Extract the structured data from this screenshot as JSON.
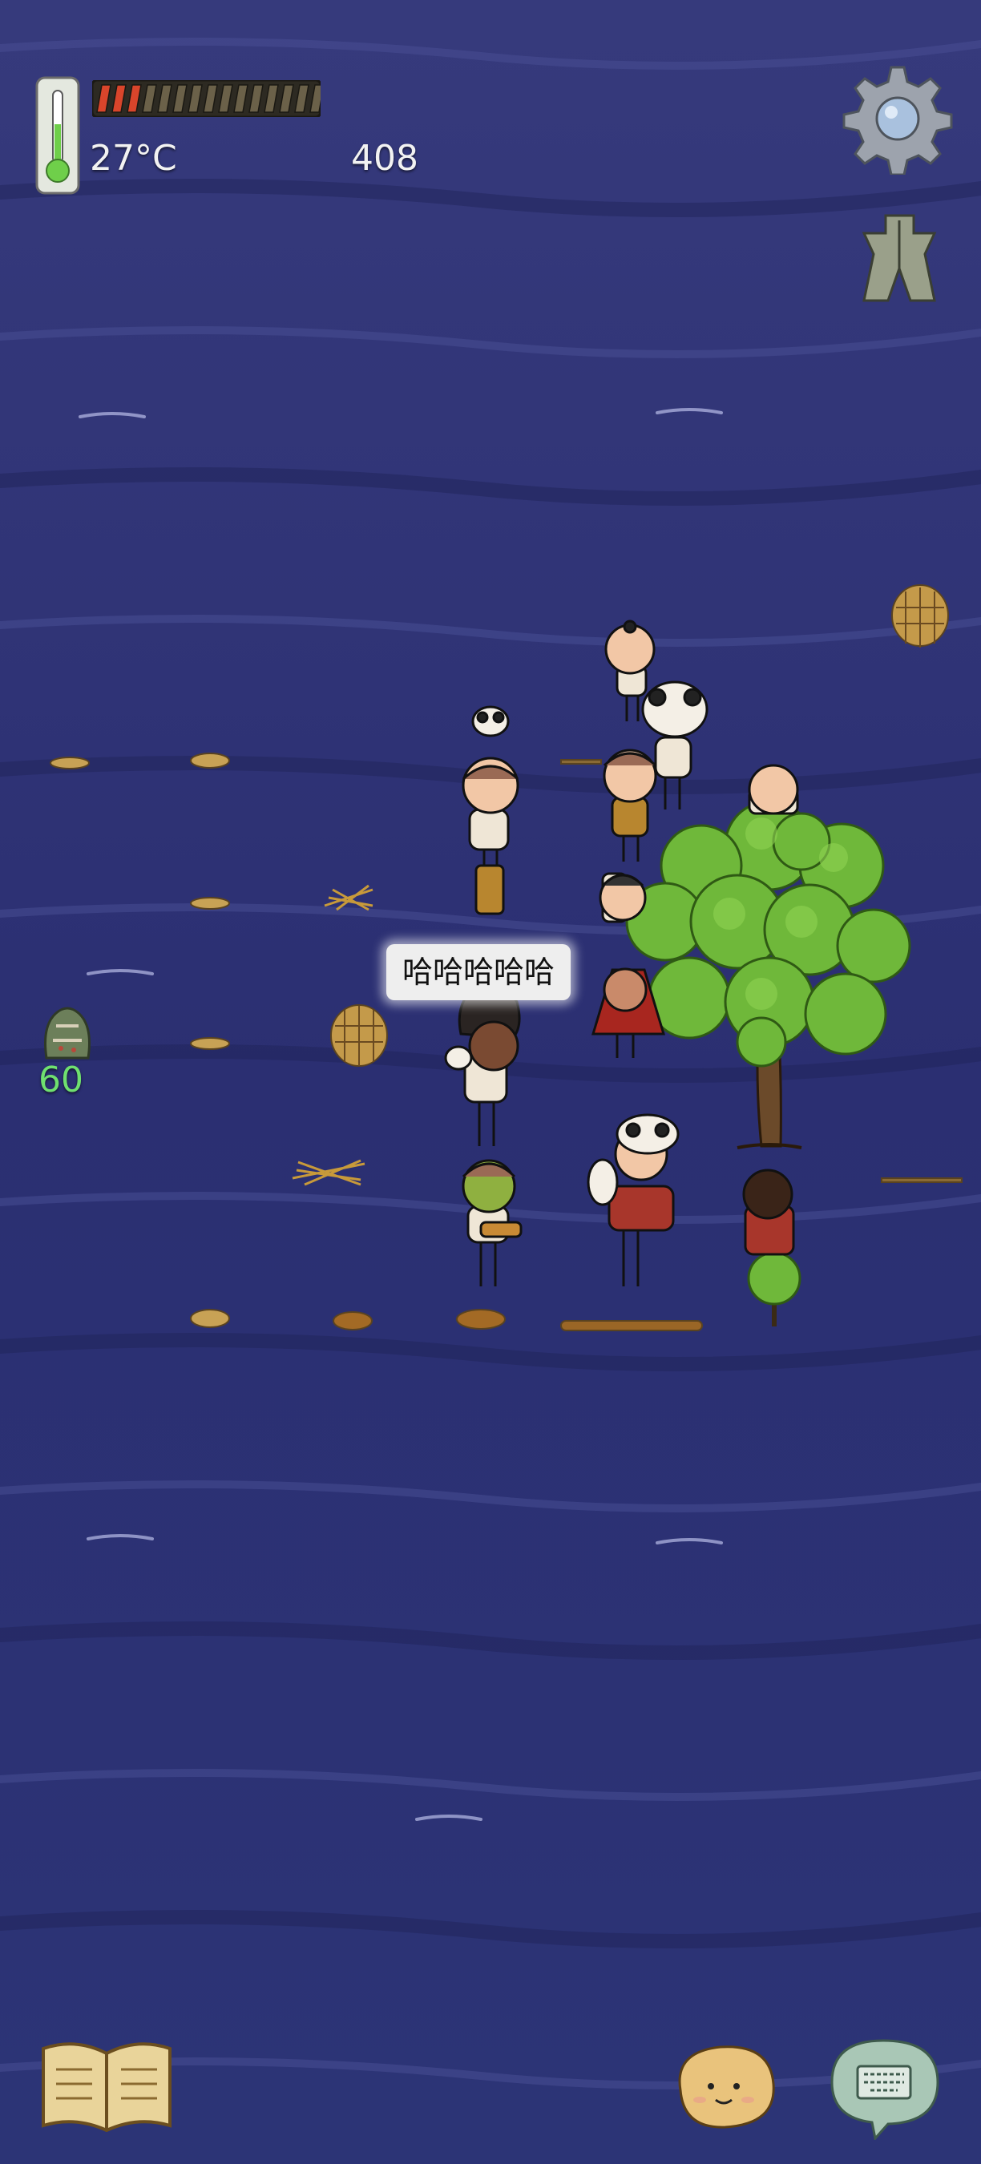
{
  "hud": {
    "temperature": "27°C",
    "food_count": "408",
    "hunger_filled": 3,
    "hunger_total": 15,
    "backpack_count": "60"
  },
  "speech_bubble": {
    "text": "哈哈哈哈哈"
  },
  "icons": {
    "thermometer": "thermometer-icon",
    "settings": "gear-icon",
    "tech_tree": "tech-tree-icon",
    "backpack": "backpack-icon",
    "recipe_book": "book-icon",
    "emote": "emote-face-icon",
    "chat": "keyboard-chat-icon"
  },
  "colors": {
    "water": "#2a2f6e",
    "hunger_filled": "#d9452b",
    "hunger_empty": "#6b6149",
    "backpack_count": "#6fe06f",
    "tree_leaves": "#6fb83a"
  }
}
